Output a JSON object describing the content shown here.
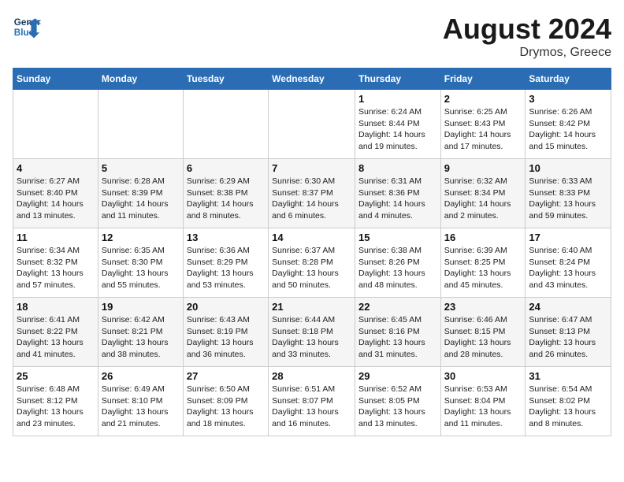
{
  "header": {
    "logo_line1": "General",
    "logo_line2": "Blue",
    "month_title": "August 2024",
    "location": "Drymos, Greece"
  },
  "days_of_week": [
    "Sunday",
    "Monday",
    "Tuesday",
    "Wednesday",
    "Thursday",
    "Friday",
    "Saturday"
  ],
  "weeks": [
    [
      {
        "day": "",
        "info": ""
      },
      {
        "day": "",
        "info": ""
      },
      {
        "day": "",
        "info": ""
      },
      {
        "day": "",
        "info": ""
      },
      {
        "day": "1",
        "info": "Sunrise: 6:24 AM\nSunset: 8:44 PM\nDaylight: 14 hours\nand 19 minutes."
      },
      {
        "day": "2",
        "info": "Sunrise: 6:25 AM\nSunset: 8:43 PM\nDaylight: 14 hours\nand 17 minutes."
      },
      {
        "day": "3",
        "info": "Sunrise: 6:26 AM\nSunset: 8:42 PM\nDaylight: 14 hours\nand 15 minutes."
      }
    ],
    [
      {
        "day": "4",
        "info": "Sunrise: 6:27 AM\nSunset: 8:40 PM\nDaylight: 14 hours\nand 13 minutes."
      },
      {
        "day": "5",
        "info": "Sunrise: 6:28 AM\nSunset: 8:39 PM\nDaylight: 14 hours\nand 11 minutes."
      },
      {
        "day": "6",
        "info": "Sunrise: 6:29 AM\nSunset: 8:38 PM\nDaylight: 14 hours\nand 8 minutes."
      },
      {
        "day": "7",
        "info": "Sunrise: 6:30 AM\nSunset: 8:37 PM\nDaylight: 14 hours\nand 6 minutes."
      },
      {
        "day": "8",
        "info": "Sunrise: 6:31 AM\nSunset: 8:36 PM\nDaylight: 14 hours\nand 4 minutes."
      },
      {
        "day": "9",
        "info": "Sunrise: 6:32 AM\nSunset: 8:34 PM\nDaylight: 14 hours\nand 2 minutes."
      },
      {
        "day": "10",
        "info": "Sunrise: 6:33 AM\nSunset: 8:33 PM\nDaylight: 13 hours\nand 59 minutes."
      }
    ],
    [
      {
        "day": "11",
        "info": "Sunrise: 6:34 AM\nSunset: 8:32 PM\nDaylight: 13 hours\nand 57 minutes."
      },
      {
        "day": "12",
        "info": "Sunrise: 6:35 AM\nSunset: 8:30 PM\nDaylight: 13 hours\nand 55 minutes."
      },
      {
        "day": "13",
        "info": "Sunrise: 6:36 AM\nSunset: 8:29 PM\nDaylight: 13 hours\nand 53 minutes."
      },
      {
        "day": "14",
        "info": "Sunrise: 6:37 AM\nSunset: 8:28 PM\nDaylight: 13 hours\nand 50 minutes."
      },
      {
        "day": "15",
        "info": "Sunrise: 6:38 AM\nSunset: 8:26 PM\nDaylight: 13 hours\nand 48 minutes."
      },
      {
        "day": "16",
        "info": "Sunrise: 6:39 AM\nSunset: 8:25 PM\nDaylight: 13 hours\nand 45 minutes."
      },
      {
        "day": "17",
        "info": "Sunrise: 6:40 AM\nSunset: 8:24 PM\nDaylight: 13 hours\nand 43 minutes."
      }
    ],
    [
      {
        "day": "18",
        "info": "Sunrise: 6:41 AM\nSunset: 8:22 PM\nDaylight: 13 hours\nand 41 minutes."
      },
      {
        "day": "19",
        "info": "Sunrise: 6:42 AM\nSunset: 8:21 PM\nDaylight: 13 hours\nand 38 minutes."
      },
      {
        "day": "20",
        "info": "Sunrise: 6:43 AM\nSunset: 8:19 PM\nDaylight: 13 hours\nand 36 minutes."
      },
      {
        "day": "21",
        "info": "Sunrise: 6:44 AM\nSunset: 8:18 PM\nDaylight: 13 hours\nand 33 minutes."
      },
      {
        "day": "22",
        "info": "Sunrise: 6:45 AM\nSunset: 8:16 PM\nDaylight: 13 hours\nand 31 minutes."
      },
      {
        "day": "23",
        "info": "Sunrise: 6:46 AM\nSunset: 8:15 PM\nDaylight: 13 hours\nand 28 minutes."
      },
      {
        "day": "24",
        "info": "Sunrise: 6:47 AM\nSunset: 8:13 PM\nDaylight: 13 hours\nand 26 minutes."
      }
    ],
    [
      {
        "day": "25",
        "info": "Sunrise: 6:48 AM\nSunset: 8:12 PM\nDaylight: 13 hours\nand 23 minutes."
      },
      {
        "day": "26",
        "info": "Sunrise: 6:49 AM\nSunset: 8:10 PM\nDaylight: 13 hours\nand 21 minutes."
      },
      {
        "day": "27",
        "info": "Sunrise: 6:50 AM\nSunset: 8:09 PM\nDaylight: 13 hours\nand 18 minutes."
      },
      {
        "day": "28",
        "info": "Sunrise: 6:51 AM\nSunset: 8:07 PM\nDaylight: 13 hours\nand 16 minutes."
      },
      {
        "day": "29",
        "info": "Sunrise: 6:52 AM\nSunset: 8:05 PM\nDaylight: 13 hours\nand 13 minutes."
      },
      {
        "day": "30",
        "info": "Sunrise: 6:53 AM\nSunset: 8:04 PM\nDaylight: 13 hours\nand 11 minutes."
      },
      {
        "day": "31",
        "info": "Sunrise: 6:54 AM\nSunset: 8:02 PM\nDaylight: 13 hours\nand 8 minutes."
      }
    ]
  ]
}
